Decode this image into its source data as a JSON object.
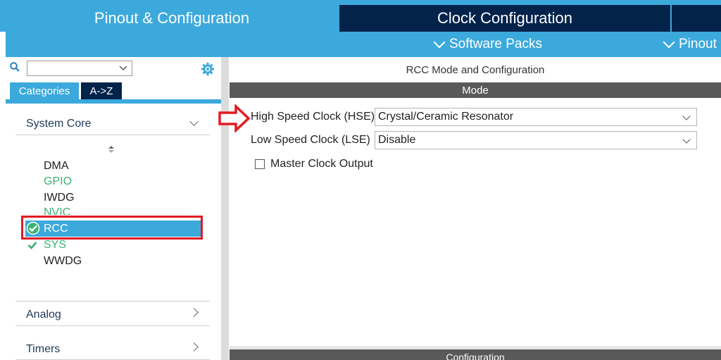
{
  "top_tabs": {
    "pinout": "Pinout & Configuration",
    "clock": "Clock Configuration"
  },
  "sub_menu": {
    "software_packs": "Software Packs",
    "pinout": "Pinout"
  },
  "left": {
    "tabs": {
      "categories": "Categories",
      "az": "A->Z"
    },
    "categories": [
      {
        "label": "System Core"
      },
      {
        "label": "Analog"
      },
      {
        "label": "Timers"
      }
    ],
    "system_core_items": [
      {
        "label": "DMA"
      },
      {
        "label": "GPIO"
      },
      {
        "label": "IWDG"
      },
      {
        "label": "NVIC"
      },
      {
        "label": "RCC"
      },
      {
        "label": "SYS"
      },
      {
        "label": "WWDG"
      }
    ]
  },
  "right": {
    "title": "RCC Mode and Configuration",
    "mode_header": "Mode",
    "hse_label": "High Speed Clock (HSE)",
    "hse_value": "Crystal/Ceramic Resonator",
    "lse_label": "Low Speed Clock (LSE)",
    "lse_value": "Disable",
    "mco_label": "Master Clock Output",
    "config_header": "Configuration"
  },
  "colors": {
    "accent": "#3ca9dc",
    "dark_tab": "#03234b",
    "green": "#3cb371",
    "highlight_red": "#e21b23",
    "selected_row": "#3ca9dc"
  },
  "icons": [
    "search-icon",
    "gear-icon",
    "chevron-down-icon",
    "chevron-right-icon",
    "check-icon",
    "arrow-annotation-icon"
  ]
}
